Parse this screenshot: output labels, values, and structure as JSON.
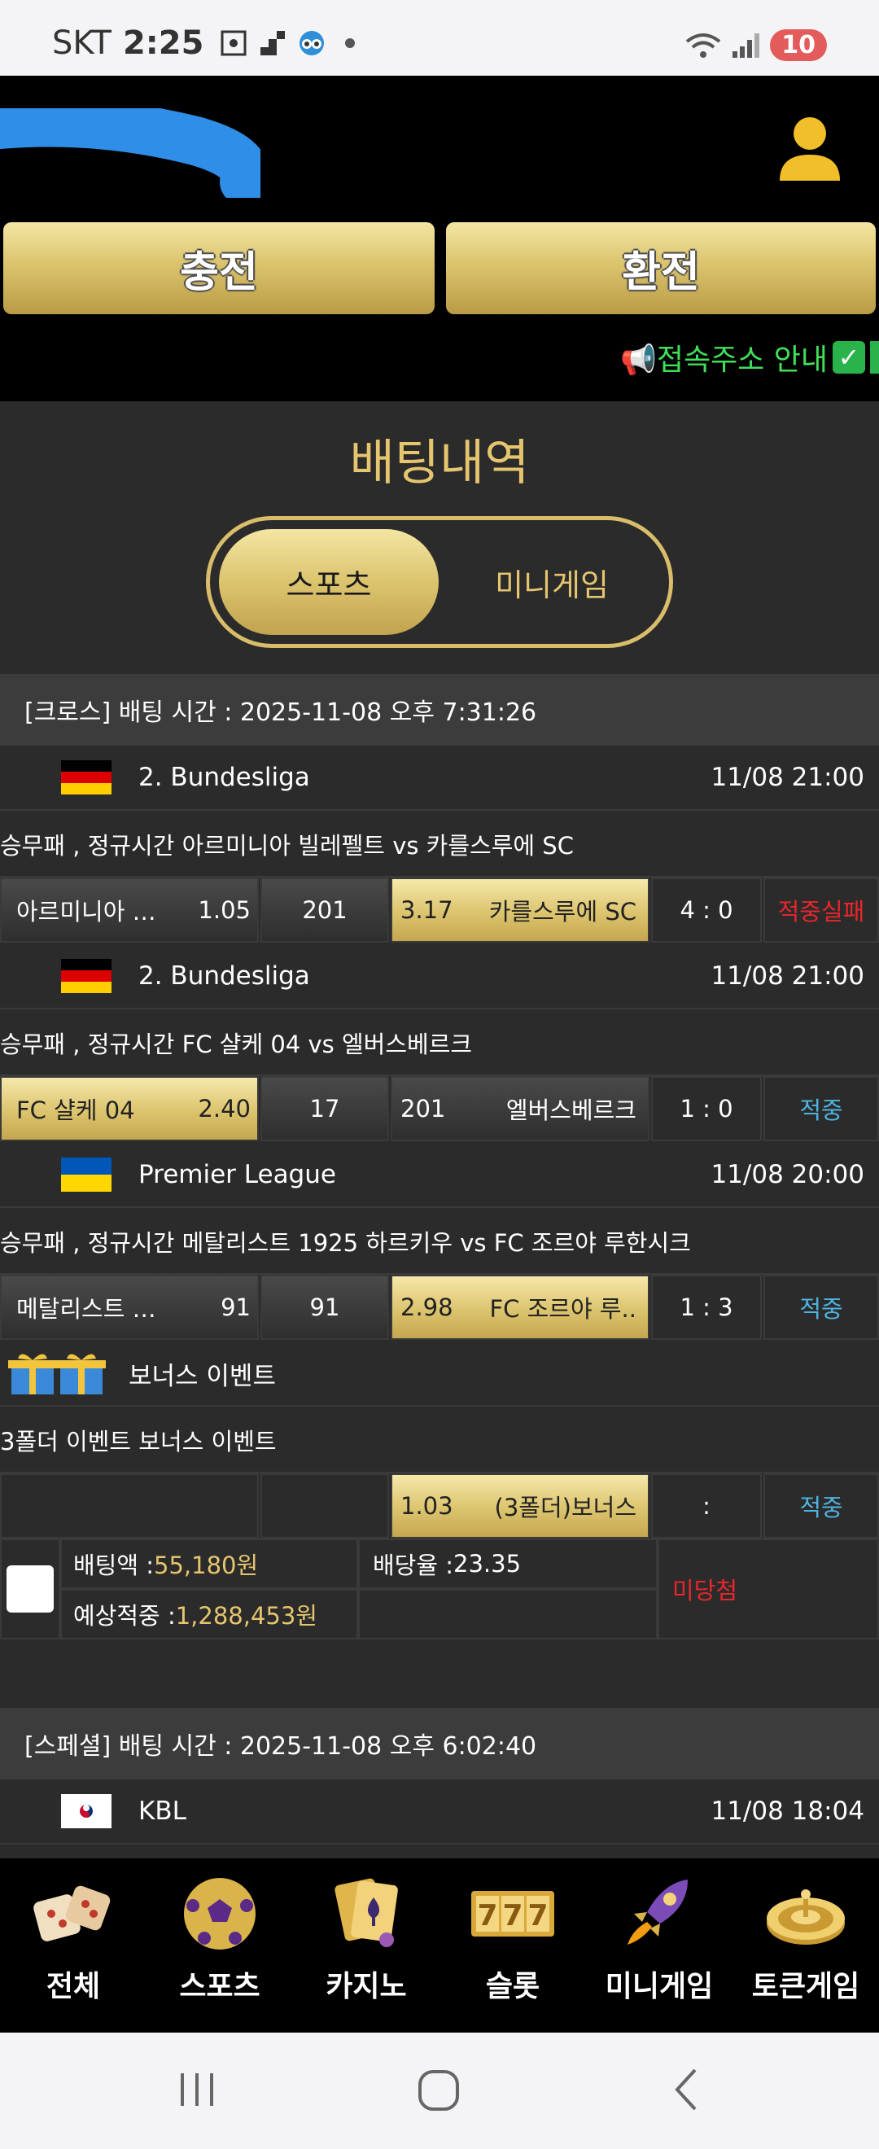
{
  "status_bar": {
    "carrier": "SKT",
    "time": "2:25",
    "battery": "10"
  },
  "header": {
    "charge_label": "충전",
    "exchange_label": "환전",
    "notice_text": "📢접속주소 안내",
    "notice_check": "✓"
  },
  "page": {
    "title": "배팅내역"
  },
  "tabs": [
    {
      "label": "스포츠",
      "active": true
    },
    {
      "label": "미니게임",
      "active": false
    }
  ],
  "bets": [
    {
      "header": "[크로스] 배팅 시간 : 2025-11-08 오후 7:31:26",
      "matches": [
        {
          "flag": "germany-flag-icon",
          "league": "2. Bundesliga",
          "time": "11/08 21:00",
          "description": "승무패 , 정규시간 아르미니아 빌레펠트  vs  카를스루에 SC",
          "home": "아르미니아 빌…",
          "home_odds": "1.05",
          "draw": "201",
          "away_odds": "3.17",
          "away": "카를스루에 SC",
          "selected": "away",
          "score": "4 : 0",
          "result": "적중실패",
          "result_type": "fail"
        },
        {
          "flag": "germany-flag-icon",
          "league": "2. Bundesliga",
          "time": "11/08 21:00",
          "description": "승무패 , 정규시간 FC 샬케 04  vs  엘버스베르크",
          "home": "FC 샬케 04",
          "home_odds": "2.40",
          "draw": "17",
          "away_odds": "201",
          "away": "엘버스베르크",
          "selected": "home",
          "score": "1 : 0",
          "result": "적중",
          "result_type": "hit"
        },
        {
          "flag": "ukraine-flag-icon",
          "league": "Premier League",
          "time": "11/08 20:00",
          "description": "승무패 , 정규시간 메탈리스트 1925 하르키우  vs  FC 조르야 루한시크",
          "home": "메탈리스트 19..",
          "home_odds": "91",
          "draw": "91",
          "away_odds": "2.98",
          "away": "FC 조르야 루..",
          "selected": "away",
          "score": "1 : 3",
          "result": "적중",
          "result_type": "hit"
        }
      ],
      "bonus": {
        "title": "보너스 이벤트",
        "description": "3폴더 이벤트 보너스 이벤트",
        "odds": "1.03",
        "label": "(3폴더)보너스",
        "score": ":",
        "result": "적중"
      },
      "summary": {
        "bet_amount_label": "배팅액 : ",
        "bet_amount": "55,180원",
        "odds_label": "배당율 : ",
        "odds": "23.35",
        "expected_label": "예상적중 : ",
        "expected": "1,288,453원",
        "status": "미당첨"
      }
    },
    {
      "header": "[스페셜] 배팅 시간 : 2025-11-08 오후 6:02:40",
      "matches": [
        {
          "flag": "korea-flag-icon",
          "league": "KBL",
          "time": "11/08 18:04"
        }
      ]
    }
  ],
  "bottom_nav": [
    {
      "label": "전체",
      "icon": "dice-icon"
    },
    {
      "label": "스포츠",
      "icon": "soccer-ball-icon"
    },
    {
      "label": "카지노",
      "icon": "cards-icon"
    },
    {
      "label": "슬롯",
      "icon": "slot-777-icon"
    },
    {
      "label": "미니게임",
      "icon": "rocket-icon"
    },
    {
      "label": "토큰게임",
      "icon": "roulette-icon"
    }
  ],
  "colors": {
    "gold": "#e6c56f",
    "background": "#2b2b2b",
    "hit": "#4eb3e0",
    "fail": "#e8262b",
    "notice": "#3fe05a"
  }
}
